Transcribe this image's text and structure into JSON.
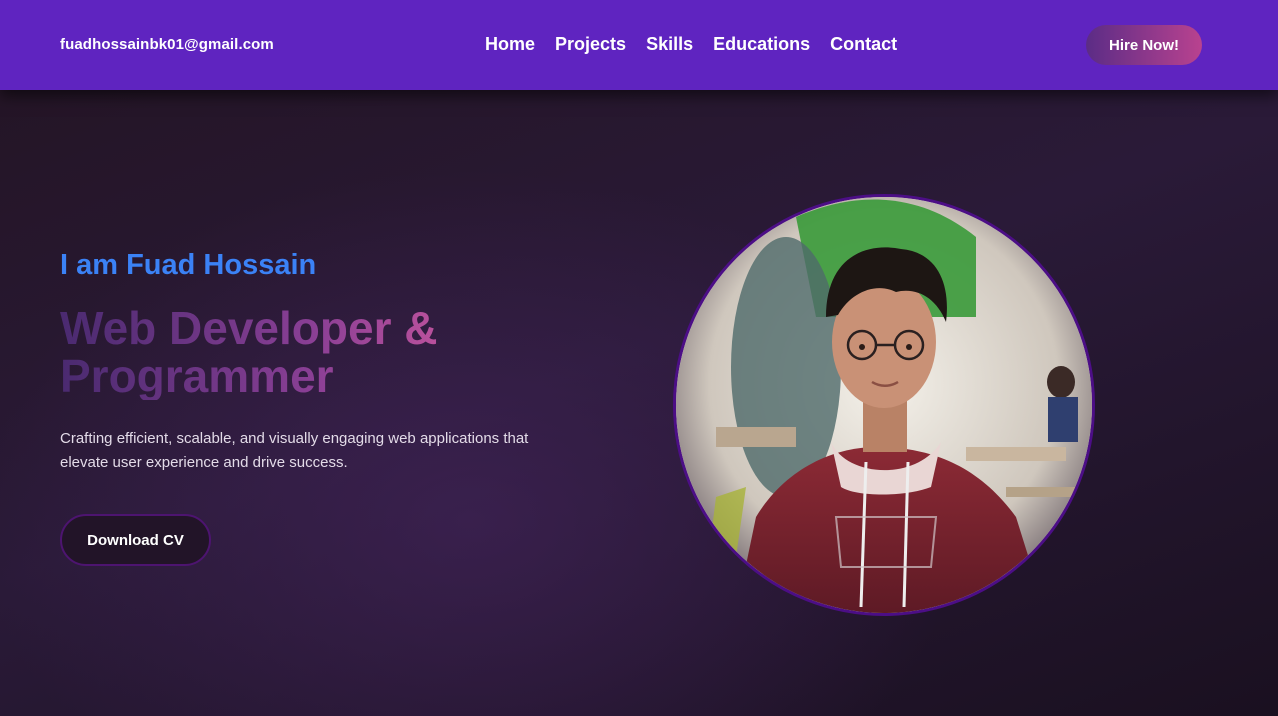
{
  "nav": {
    "email": "fuadhossainbk01@gmail.com",
    "links": [
      "Home",
      "Projects",
      "Skills",
      "Educations",
      "Contact"
    ],
    "hire_label": "Hire Now!"
  },
  "hero": {
    "intro": "I am Fuad Hossain",
    "title": "Web Developer & Programmer",
    "tagline": "Crafting efficient, scalable, and visually engaging web applications that elevate user experience and drive success.",
    "cv_label": "Download CV"
  },
  "colors": {
    "navbar": "#5f24c0",
    "intro_accent": "#3b82f6",
    "photo_border": "#4c0e86"
  }
}
